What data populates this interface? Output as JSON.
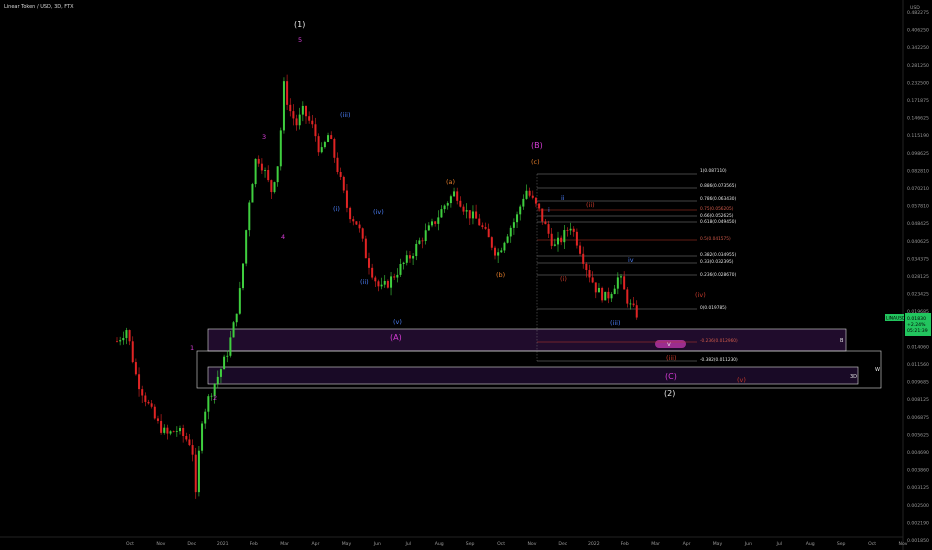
{
  "header": {
    "title": "Linear Token / USD, 3D, FTX"
  },
  "price_axis": {
    "unit": "USD",
    "labels": [
      "0.482275",
      "0.406250",
      "0.342250",
      "0.281250",
      "0.232500",
      "0.171875",
      "0.146625",
      "0.115190",
      "0.098625",
      "0.082810",
      "0.070210",
      "0.057810",
      "0.048425",
      "0.040625",
      "0.034375",
      "0.028125",
      "0.023425",
      "0.019685",
      "0.016980",
      "0.014060",
      "0.011560",
      "0.009685",
      "0.008125",
      "0.006875",
      "0.005625",
      "0.004690",
      "0.003860",
      "0.003125",
      "0.002500",
      "0.002190",
      "0.001850"
    ],
    "tag_symbol": "LINAUSD",
    "tag_lines": [
      "0.01830",
      "+2.24%",
      "05:21:39"
    ],
    "tag_color": "#22c55e"
  },
  "time_axis": {
    "labels": [
      "Oct",
      "Nov",
      "Dec",
      "2021",
      "Feb",
      "Mar",
      "Apr",
      "May",
      "Jun",
      "Jul",
      "Aug",
      "Sep",
      "Oct",
      "Nov",
      "Dec",
      "2022",
      "Feb",
      "Mar",
      "Apr",
      "May",
      "Jun",
      "Jul",
      "Aug",
      "Sep",
      "Oct",
      "Nov"
    ]
  },
  "fib_levels": [
    {
      "label": "1(0.087110)",
      "tone": "white"
    },
    {
      "label": "0.886(0.073565)",
      "tone": "white"
    },
    {
      "label": "0.786(0.063430)",
      "tone": "white"
    },
    {
      "label": "0.75(0.056205)",
      "tone": "red"
    },
    {
      "label": "0.66(0.052625)",
      "tone": "white"
    },
    {
      "label": "0.618(0.049450)",
      "tone": "white"
    },
    {
      "label": "0.5(0.041575)",
      "tone": "red"
    },
    {
      "label": "0.382(0.034955)",
      "tone": "white"
    },
    {
      "label": "0.33(0.032395)",
      "tone": "white"
    },
    {
      "label": "0.236(0.028670)",
      "tone": "white"
    },
    {
      "label": "0(0.019785)",
      "tone": "white"
    },
    {
      "label": "-0.236(0.012960)",
      "tone": "red"
    },
    {
      "label": "-0.382(0.011230)",
      "tone": "white"
    }
  ],
  "zones": [
    {
      "label": "B"
    },
    {
      "label": "W"
    },
    {
      "label": "3D"
    }
  ],
  "annotations": [
    {
      "text": "(1)",
      "color": "#e6e6e6"
    },
    {
      "text": "5",
      "color": "#d63cd6"
    },
    {
      "text": "3",
      "color": "#d63cd6"
    },
    {
      "text": "4",
      "color": "#d63cd6"
    },
    {
      "text": "1",
      "color": "#d63cd6"
    },
    {
      "text": "2",
      "color": "#d63cd6"
    },
    {
      "text": "(iii)",
      "color": "#4a7bf0"
    },
    {
      "text": "(i)",
      "color": "#4a7bf0"
    },
    {
      "text": "(iv)",
      "color": "#4a7bf0"
    },
    {
      "text": "(ii)",
      "color": "#4a7bf0"
    },
    {
      "text": "(v)",
      "color": "#4a7bf0"
    },
    {
      "text": "(A)",
      "color": "#d63cd6"
    },
    {
      "text": "(a)",
      "color": "#e07b2a"
    },
    {
      "text": "(b)",
      "color": "#e07b2a"
    },
    {
      "text": "(c)",
      "color": "#e07b2a"
    },
    {
      "text": "(B)",
      "color": "#d63cd6"
    },
    {
      "text": "ii",
      "color": "#4a7bf0"
    },
    {
      "text": "i",
      "color": "#4a7bf0"
    },
    {
      "text": "(ii)",
      "color": "#c0392b"
    },
    {
      "text": "(i)",
      "color": "#c0392b"
    },
    {
      "text": "iv",
      "color": "#4a7bf0"
    },
    {
      "text": "(iii)",
      "color": "#4a7bf0"
    },
    {
      "text": "(iv)",
      "color": "#c0392b"
    },
    {
      "text": "v",
      "color": "#e6e6e6"
    },
    {
      "text": "(iii)",
      "color": "#c0392b"
    },
    {
      "text": "(C)",
      "color": "#d63cd6"
    },
    {
      "text": "(v)",
      "color": "#c0392b"
    },
    {
      "text": "(2)",
      "color": "#e6e6e6"
    }
  ],
  "chart_data": {
    "type": "candlestick",
    "title": "Linear Token / USD, 3D, FTX",
    "y_scale": "log",
    "ylim": [
      0.00185,
      0.482275
    ],
    "x_range": [
      "2020-09-15",
      "2022-11-30"
    ],
    "series": [
      {
        "points": [
          [
            "2020-09-15",
            0.014
          ],
          [
            "2020-09-25",
            0.016
          ],
          [
            "2020-10-05",
            0.0095
          ],
          [
            "2020-10-15",
            0.0075
          ],
          [
            "2020-10-25",
            0.006
          ],
          [
            "2020-11-05",
            0.0052
          ],
          [
            "2020-11-15",
            0.0055
          ],
          [
            "2020-11-25",
            0.005
          ],
          [
            "2020-12-01",
            0.0047
          ],
          [
            "2020-12-05",
            0.0026
          ],
          [
            "2020-12-10",
            0.006
          ],
          [
            "2020-12-20",
            0.0082
          ],
          [
            "2020-12-28",
            0.0098
          ],
          [
            "2021-01-05",
            0.012
          ],
          [
            "2021-01-12",
            0.016
          ],
          [
            "2021-01-20",
            0.025
          ],
          [
            "2021-01-28",
            0.06
          ],
          [
            "2021-02-05",
            0.1
          ],
          [
            "2021-02-12",
            0.088
          ],
          [
            "2021-02-20",
            0.068
          ],
          [
            "2021-02-28",
            0.096
          ],
          [
            "2021-03-05",
            0.21
          ],
          [
            "2021-03-10",
            0.165
          ],
          [
            "2021-03-18",
            0.138
          ],
          [
            "2021-03-25",
            0.16
          ],
          [
            "2021-04-05",
            0.13
          ],
          [
            "2021-04-12",
            0.1
          ],
          [
            "2021-04-20",
            0.125
          ],
          [
            "2021-05-01",
            0.08
          ],
          [
            "2021-05-10",
            0.055
          ],
          [
            "2021-05-20",
            0.048
          ],
          [
            "2021-05-28",
            0.035
          ],
          [
            "2021-06-05",
            0.028
          ],
          [
            "2021-06-12",
            0.024
          ],
          [
            "2021-06-20",
            0.026
          ],
          [
            "2021-07-01",
            0.03
          ],
          [
            "2021-07-12",
            0.034
          ],
          [
            "2021-07-25",
            0.042
          ],
          [
            "2021-08-05",
            0.048
          ],
          [
            "2021-08-18",
            0.06
          ],
          [
            "2021-08-28",
            0.068
          ],
          [
            "2021-09-08",
            0.055
          ],
          [
            "2021-09-20",
            0.05
          ],
          [
            "2021-09-30",
            0.042
          ],
          [
            "2021-10-10",
            0.035
          ],
          [
            "2021-10-20",
            0.044
          ],
          [
            "2021-10-30",
            0.052
          ],
          [
            "2021-11-08",
            0.07
          ],
          [
            "2021-11-15",
            0.062
          ],
          [
            "2021-11-22",
            0.055
          ],
          [
            "2021-11-30",
            0.045
          ],
          [
            "2021-12-08",
            0.038
          ],
          [
            "2021-12-16",
            0.042
          ],
          [
            "2021-12-24",
            0.048
          ],
          [
            "2022-01-02",
            0.038
          ],
          [
            "2022-01-10",
            0.03
          ],
          [
            "2022-01-20",
            0.024
          ],
          [
            "2022-01-30",
            0.022
          ],
          [
            "2022-02-06",
            0.025
          ],
          [
            "2022-02-12",
            0.028
          ],
          [
            "2022-02-18",
            0.023
          ],
          [
            "2022-02-24",
            0.02
          ],
          [
            "2022-03-04",
            0.0183
          ]
        ]
      }
    ]
  }
}
